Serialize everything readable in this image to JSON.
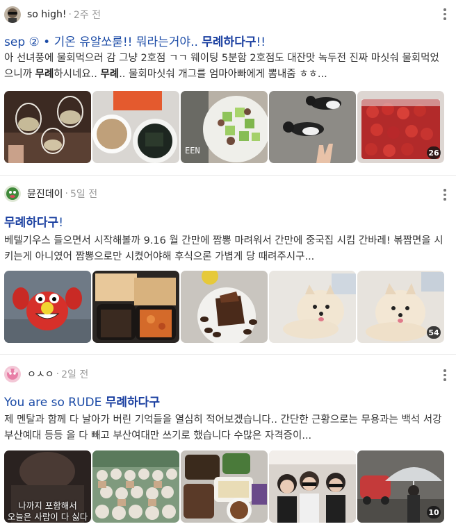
{
  "posts": [
    {
      "author": "so high!",
      "time": "2주 전",
      "title_prefix": "sep ② • 기온 유알쏘룯!! 뭐라는거야.. ",
      "title_keyword": "무례하다구",
      "title_suffix": "!!",
      "desc_1": "아 선녀풍에 물회먹으러 감 그냥 2호점 ㄱㄱ 웨이팅 5분함 2호점도 대잔맛 녹두전 진짜 마싯숴 물회먹었으니까 ",
      "desc_kw1": "무례",
      "desc_2": "하시네요.. ",
      "desc_kw2": "무례",
      "desc_3": ".. 물회마싯숴 개그를 엄마아빠에게 뽐내줌 ㅎㅎ...",
      "photo_count": "26",
      "thumbs": [
        "wine-glasses-photo",
        "rice-and-seaweed-photo",
        "cucumber-salad-photo",
        "cats-on-ground-photo",
        "strawberries-photo"
      ]
    },
    {
      "author": "뮨진데이",
      "time": "5일 전",
      "title_prefix": "",
      "title_keyword": "무례하다구",
      "title_suffix": "!",
      "desc_1": "베텔기우스 들으면서 시작해볼까 9.16 월 간만에 짬뽕 마려워서 간만에 중국집 시킴 간바레! 볶짬면을 시키는게 아니였어 짬뽕으로만 시켰어야해 후식으론 가볍게 당 때려주시구...",
      "photo_count": "54",
      "thumbs": [
        "crab-cartoon-photo",
        "chinese-food-photo",
        "chocolate-dessert-photo",
        "white-dog-photo",
        "white-dog-closeup-photo"
      ]
    },
    {
      "author": "ㅇㅅㅇ",
      "time": "2일 전",
      "title_prefix": "You are so RUDE ",
      "title_keyword": "무례하다구",
      "title_suffix": "",
      "desc_1": "제 멘탈과 함께 다 날아가 버린 기억들을 열심히 적어보겠습니다.. 간단한 근황으로는 무용과는 백석 서강 부산예대 등등 을 다 빼고 부산여대만 쓰기로 했습니다 수많은 자격증이...",
      "photo_count": "10",
      "thumb1_caption_a": "나까지 포함해서",
      "thumb1_caption_b": "오늘은 사람이 다 싫다",
      "thumbs": [
        "dark-screenshot-photo",
        "figurines-photo",
        "side-dishes-photo",
        "group-photo",
        "umbrella-street-photo"
      ]
    }
  ]
}
